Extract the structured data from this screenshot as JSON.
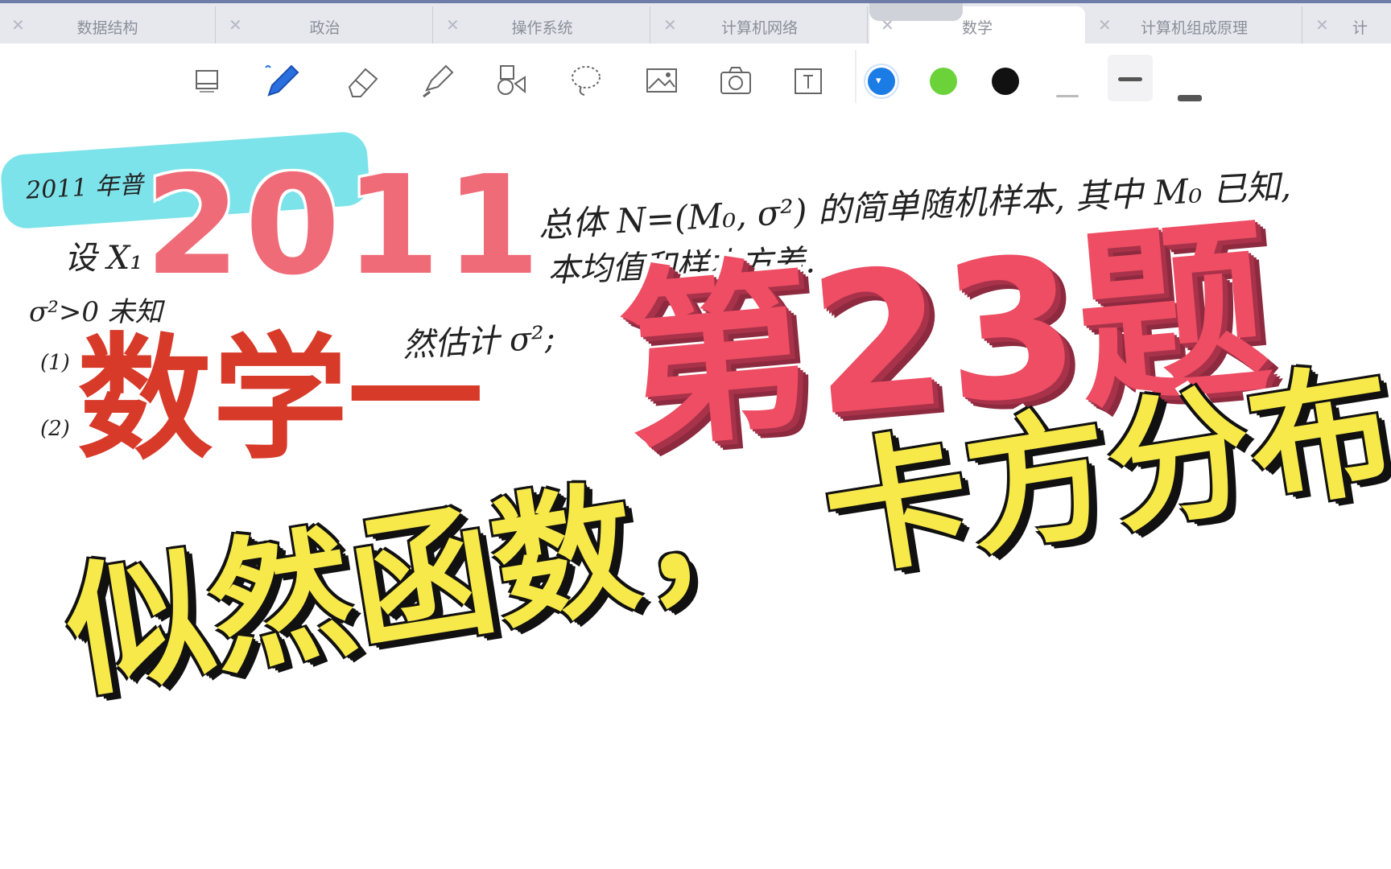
{
  "tabs": [
    {
      "label": "数据结构"
    },
    {
      "label": "政治"
    },
    {
      "label": "操作系统"
    },
    {
      "label": "计算机网络"
    },
    {
      "label": "数学"
    },
    {
      "label": "计算机组成原理"
    },
    {
      "label": "计"
    }
  ],
  "active_tab_index": 4,
  "toolbar": {
    "tools": [
      "page-layout-icon",
      "pen-icon",
      "eraser-icon",
      "highlighter-icon",
      "shapes-icon",
      "lasso-icon",
      "image-icon",
      "camera-icon",
      "text-box-icon"
    ],
    "colors": [
      "#1c7ce6",
      "#6cd23a",
      "#111111"
    ],
    "thickness_levels": [
      "thin",
      "medium",
      "thick"
    ]
  },
  "notes": {
    "line1_left": "2011 年普",
    "line1_right": "总体 N=(M₀, σ²) 的简单随机样本, 其中 M₀ 已知,",
    "line2_left": "设 X₁",
    "line2_right": "本均值和样本方差.",
    "line3": "σ²>0 未知",
    "line4": "然估计 σ²;",
    "item1": "(1)",
    "item2": "(2)"
  },
  "overlay": {
    "year": "2011",
    "subject": "数学一",
    "question": "第23题",
    "topic": "似然函数， 卡方分布"
  }
}
